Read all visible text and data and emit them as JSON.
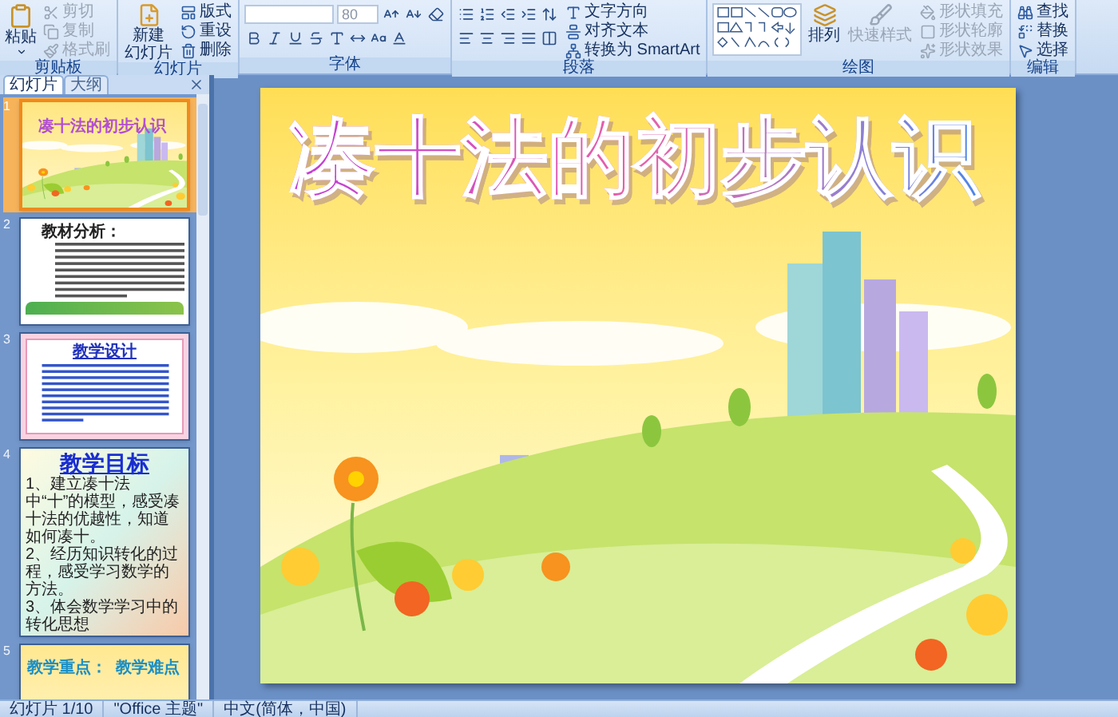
{
  "ribbon": {
    "groups": [
      {
        "kind": "clipboard",
        "label": "剪贴板",
        "buttons": [
          {
            "label": "粘贴",
            "disabled": false
          },
          {
            "label": "剪切",
            "disabled": true
          },
          {
            "label": "复制",
            "disabled": true
          },
          {
            "label": "格式刷",
            "disabled": true
          }
        ]
      },
      {
        "kind": "slides",
        "label": "幻灯片",
        "buttons": [
          {
            "lines": [
              "新建",
              "幻灯片"
            ]
          },
          {
            "label": "版式"
          },
          {
            "label": "重设"
          },
          {
            "label": "删除"
          }
        ]
      },
      {
        "kind": "font",
        "label": "字体",
        "font_size": "80"
      },
      {
        "kind": "paragraph",
        "label": "段落",
        "buttons": [
          {
            "label": "文字方向"
          },
          {
            "label": "对齐文本"
          },
          {
            "label": "转换为 SmartArt"
          }
        ]
      },
      {
        "kind": "drawing",
        "label": "绘图",
        "buttons": [
          {
            "label": "排列",
            "disabled": false
          },
          {
            "label": "快速样式",
            "disabled": true
          },
          {
            "label": "形状填充",
            "disabled": true
          },
          {
            "label": "形状轮廓",
            "disabled": true
          },
          {
            "label": "形状效果",
            "disabled": true
          }
        ]
      },
      {
        "kind": "editing",
        "label": "编辑",
        "buttons": [
          {
            "label": "查找"
          },
          {
            "label": "替换"
          },
          {
            "label": "选择"
          }
        ]
      }
    ]
  },
  "panel": {
    "tabs": [
      {
        "label": "幻灯片",
        "selected": true
      },
      {
        "label": "大纲",
        "selected": false
      }
    ],
    "slides": [
      {
        "number": "1",
        "selected": true,
        "kind": "title",
        "title": "凑十法的初步认识"
      },
      {
        "number": "2",
        "selected": false,
        "kind": "text",
        "title": "教材分析："
      },
      {
        "number": "3",
        "selected": false,
        "kind": "frame",
        "title": "教学设计"
      },
      {
        "number": "4",
        "selected": false,
        "kind": "list",
        "title": "教学目标",
        "items": [
          "1、建立凑十法中“十”的模型，感受凑十法的优越性，知道如何凑十。",
          "2、经历知识转化的过程，感受学习数学的方法。",
          "3、体会数学学习中的转化思想"
        ]
      },
      {
        "number": "5",
        "selected": false,
        "kind": "heading",
        "title": "教学重点：  教学难点"
      }
    ]
  },
  "slide": {
    "title": "凑十法的初步认识"
  },
  "status_bar": [
    "幻灯片 1/10",
    "\"Office 主题\"",
    "中文(简体，中国)"
  ]
}
